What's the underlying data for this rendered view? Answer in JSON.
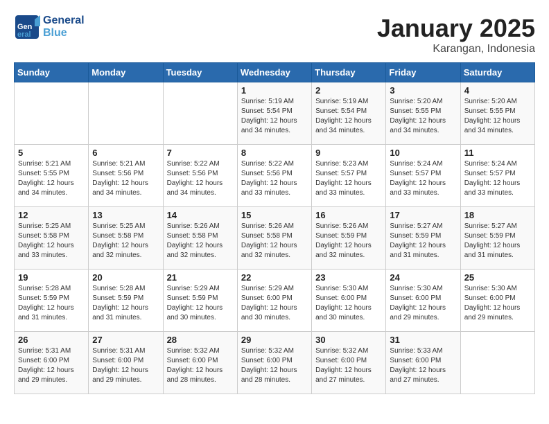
{
  "header": {
    "logo_general": "General",
    "logo_blue": "Blue",
    "title": "January 2025",
    "subtitle": "Karangan, Indonesia"
  },
  "weekdays": [
    "Sunday",
    "Monday",
    "Tuesday",
    "Wednesday",
    "Thursday",
    "Friday",
    "Saturday"
  ],
  "weeks": [
    [
      {
        "day": "",
        "info": ""
      },
      {
        "day": "",
        "info": ""
      },
      {
        "day": "",
        "info": ""
      },
      {
        "day": "1",
        "info": "Sunrise: 5:19 AM\nSunset: 5:54 PM\nDaylight: 12 hours\nand 34 minutes."
      },
      {
        "day": "2",
        "info": "Sunrise: 5:19 AM\nSunset: 5:54 PM\nDaylight: 12 hours\nand 34 minutes."
      },
      {
        "day": "3",
        "info": "Sunrise: 5:20 AM\nSunset: 5:55 PM\nDaylight: 12 hours\nand 34 minutes."
      },
      {
        "day": "4",
        "info": "Sunrise: 5:20 AM\nSunset: 5:55 PM\nDaylight: 12 hours\nand 34 minutes."
      }
    ],
    [
      {
        "day": "5",
        "info": "Sunrise: 5:21 AM\nSunset: 5:55 PM\nDaylight: 12 hours\nand 34 minutes."
      },
      {
        "day": "6",
        "info": "Sunrise: 5:21 AM\nSunset: 5:56 PM\nDaylight: 12 hours\nand 34 minutes."
      },
      {
        "day": "7",
        "info": "Sunrise: 5:22 AM\nSunset: 5:56 PM\nDaylight: 12 hours\nand 34 minutes."
      },
      {
        "day": "8",
        "info": "Sunrise: 5:22 AM\nSunset: 5:56 PM\nDaylight: 12 hours\nand 33 minutes."
      },
      {
        "day": "9",
        "info": "Sunrise: 5:23 AM\nSunset: 5:57 PM\nDaylight: 12 hours\nand 33 minutes."
      },
      {
        "day": "10",
        "info": "Sunrise: 5:24 AM\nSunset: 5:57 PM\nDaylight: 12 hours\nand 33 minutes."
      },
      {
        "day": "11",
        "info": "Sunrise: 5:24 AM\nSunset: 5:57 PM\nDaylight: 12 hours\nand 33 minutes."
      }
    ],
    [
      {
        "day": "12",
        "info": "Sunrise: 5:25 AM\nSunset: 5:58 PM\nDaylight: 12 hours\nand 33 minutes."
      },
      {
        "day": "13",
        "info": "Sunrise: 5:25 AM\nSunset: 5:58 PM\nDaylight: 12 hours\nand 32 minutes."
      },
      {
        "day": "14",
        "info": "Sunrise: 5:26 AM\nSunset: 5:58 PM\nDaylight: 12 hours\nand 32 minutes."
      },
      {
        "day": "15",
        "info": "Sunrise: 5:26 AM\nSunset: 5:58 PM\nDaylight: 12 hours\nand 32 minutes."
      },
      {
        "day": "16",
        "info": "Sunrise: 5:26 AM\nSunset: 5:59 PM\nDaylight: 12 hours\nand 32 minutes."
      },
      {
        "day": "17",
        "info": "Sunrise: 5:27 AM\nSunset: 5:59 PM\nDaylight: 12 hours\nand 31 minutes."
      },
      {
        "day": "18",
        "info": "Sunrise: 5:27 AM\nSunset: 5:59 PM\nDaylight: 12 hours\nand 31 minutes."
      }
    ],
    [
      {
        "day": "19",
        "info": "Sunrise: 5:28 AM\nSunset: 5:59 PM\nDaylight: 12 hours\nand 31 minutes."
      },
      {
        "day": "20",
        "info": "Sunrise: 5:28 AM\nSunset: 5:59 PM\nDaylight: 12 hours\nand 31 minutes."
      },
      {
        "day": "21",
        "info": "Sunrise: 5:29 AM\nSunset: 5:59 PM\nDaylight: 12 hours\nand 30 minutes."
      },
      {
        "day": "22",
        "info": "Sunrise: 5:29 AM\nSunset: 6:00 PM\nDaylight: 12 hours\nand 30 minutes."
      },
      {
        "day": "23",
        "info": "Sunrise: 5:30 AM\nSunset: 6:00 PM\nDaylight: 12 hours\nand 30 minutes."
      },
      {
        "day": "24",
        "info": "Sunrise: 5:30 AM\nSunset: 6:00 PM\nDaylight: 12 hours\nand 29 minutes."
      },
      {
        "day": "25",
        "info": "Sunrise: 5:30 AM\nSunset: 6:00 PM\nDaylight: 12 hours\nand 29 minutes."
      }
    ],
    [
      {
        "day": "26",
        "info": "Sunrise: 5:31 AM\nSunset: 6:00 PM\nDaylight: 12 hours\nand 29 minutes."
      },
      {
        "day": "27",
        "info": "Sunrise: 5:31 AM\nSunset: 6:00 PM\nDaylight: 12 hours\nand 29 minutes."
      },
      {
        "day": "28",
        "info": "Sunrise: 5:32 AM\nSunset: 6:00 PM\nDaylight: 12 hours\nand 28 minutes."
      },
      {
        "day": "29",
        "info": "Sunrise: 5:32 AM\nSunset: 6:00 PM\nDaylight: 12 hours\nand 28 minutes."
      },
      {
        "day": "30",
        "info": "Sunrise: 5:32 AM\nSunset: 6:00 PM\nDaylight: 12 hours\nand 27 minutes."
      },
      {
        "day": "31",
        "info": "Sunrise: 5:33 AM\nSunset: 6:00 PM\nDaylight: 12 hours\nand 27 minutes."
      },
      {
        "day": "",
        "info": ""
      }
    ]
  ]
}
